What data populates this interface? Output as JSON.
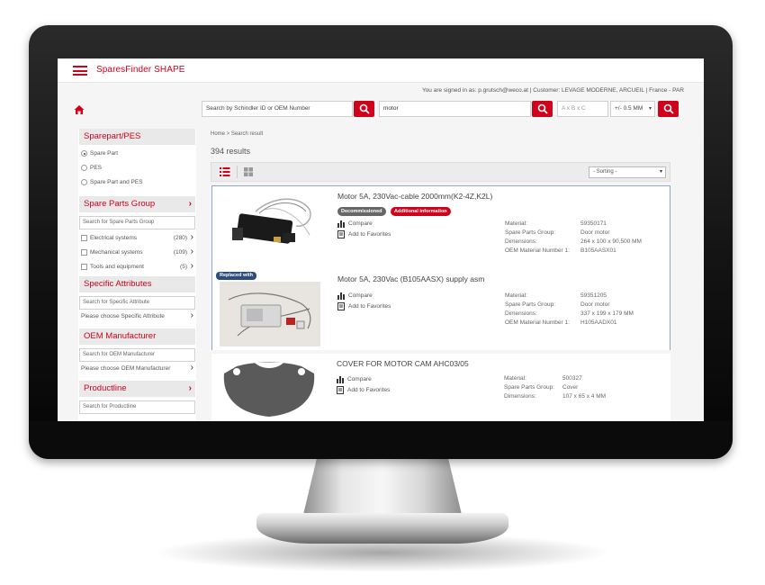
{
  "app": {
    "brand": "SparesFinder SHAPE"
  },
  "header": {
    "user_line": "You are signed in as: p.grutsch@weco.at  |  Customer: LEVAGE MODERNE, ARCUEIL  |  France - PAR"
  },
  "search": {
    "id_placeholder": "Search by Schindler ID or OEM Number",
    "keyword_value": "motor",
    "dimensions_placeholder": "A x B x C",
    "tolerance_value": "+/- 0.5 MM"
  },
  "sidebar": {
    "sparepart": {
      "title": "Sparepart/PES",
      "options": [
        "Spare Part",
        "PES",
        "Spare Part and PES"
      ]
    },
    "spare_parts_group": {
      "title": "Spare Parts Group",
      "search_placeholder": "Search for Spare Parts Group",
      "items": [
        {
          "label": "Electrical systems",
          "count": "(280)"
        },
        {
          "label": "Mechanical systems",
          "count": "(109)"
        },
        {
          "label": "Tools and equipment",
          "count": "(5)"
        }
      ]
    },
    "specific_attributes": {
      "title": "Specific Attributes",
      "search_placeholder": "Search for Specific Attribute",
      "choose": "Please choose Specific Attribute"
    },
    "oem_manufacturer": {
      "title": "OEM Manufacturer",
      "search_placeholder": "Search for OEM Manufacturer",
      "choose": "Please choose OEM Manufacturer"
    },
    "productline": {
      "title": "Productline",
      "search_placeholder": "Search for Productline"
    }
  },
  "results": {
    "breadcrumb": "Home > Search result",
    "count": "394 results",
    "sort_placeholder": "- Sorting -",
    "labels": {
      "material": "Material:",
      "group": "Spare Parts Group:",
      "dimensions": "Dimensions:",
      "oem": "OEM Material Number 1:",
      "compare": "Compare",
      "favorites": "Add to Favorites"
    },
    "items": [
      {
        "title": "Motor 5A, 230Vac-cable 2000mm(K2-4Z,K2L)",
        "badges": [
          "Decommissioned",
          "Additional information"
        ],
        "material": "59350171",
        "group": "Door motor",
        "dimensions": "264 x 100 x 90,500 MM",
        "oem": "B105AASX01"
      },
      {
        "tag": "Replaced with",
        "title": "Motor 5A, 230Vac (B105AASX) supply asm",
        "material": "59351205",
        "group": "Door motor",
        "dimensions": "337 x 199 x 179 MM",
        "oem": "H105AADX01"
      },
      {
        "title": "COVER FOR MOTOR CAM AHC03/05",
        "material": "500327",
        "group": "Cover",
        "dimensions": "107 x 65 x 4 MM"
      }
    ]
  },
  "colors": {
    "accent": "#d0021b",
    "badge_grey": "#666666",
    "tag_navy": "#2d4d7a"
  }
}
